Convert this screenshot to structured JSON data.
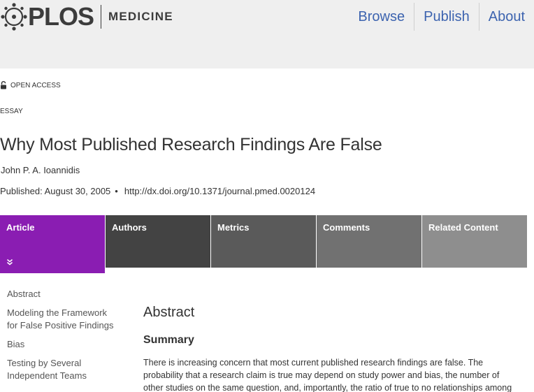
{
  "header": {
    "logo_word": "PLOS",
    "journal": "MEDICINE",
    "nav": [
      "Browse",
      "Publish",
      "About"
    ]
  },
  "article": {
    "access": "OPEN ACCESS",
    "type": "ESSAY",
    "title": "Why Most Published Research Findings Are False",
    "author": "John P. A. Ioannidis",
    "published": "Published: August 30, 2005",
    "bullet": "•",
    "doi": "http://dx.doi.org/10.1371/journal.pmed.0020124"
  },
  "tabs": [
    "Article",
    "Authors",
    "Metrics",
    "Comments",
    "Related Content"
  ],
  "sidebar": {
    "items": [
      "Abstract",
      "Modeling the Framework for False Positive Findings",
      "Bias",
      "Testing by Several Independent Teams"
    ]
  },
  "main": {
    "heading": "Abstract",
    "subheading": "Summary",
    "text": "There is increasing concern that most current published research findings are false. The probability that a research claim is true may depend on study power and bias, the number of other studies on the same question, and, importantly, the ratio of true to no relationships among"
  },
  "colors": {
    "accent": "#8a1db2",
    "nav_link": "#3c63af",
    "header_bg": "#efefef"
  }
}
